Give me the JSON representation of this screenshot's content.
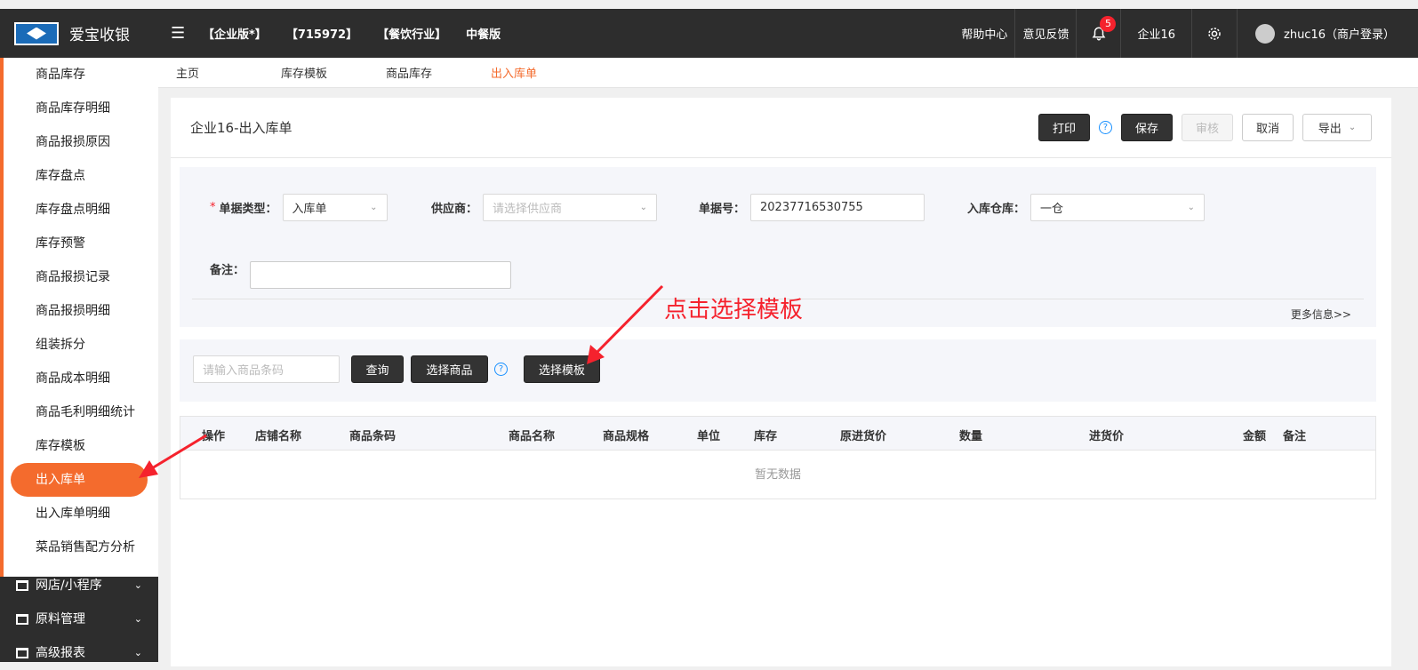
{
  "app": {
    "title": "爱宝收银"
  },
  "topbar": {
    "tags": [
      "【企业版*】",
      "【715972】",
      "【餐饮行业】",
      "中餐版"
    ],
    "help": "帮助中心",
    "feedback": "意见反馈",
    "notification_count": "5",
    "company": "企业16",
    "user": "zhuc16（商户登录）"
  },
  "sidebar": {
    "sub_items": [
      "商品库存",
      "商品库存明细",
      "商品报损原因",
      "库存盘点",
      "库存盘点明细",
      "库存预警",
      "商品报损记录",
      "商品报损明细",
      "组装拆分",
      "商品成本明细",
      "商品毛利明细统计",
      "库存模板",
      "出入库单",
      "出入库单明细",
      "菜品销售配方分析"
    ],
    "active": "出入库单",
    "main_items": [
      "网店/小程序",
      "原料管理",
      "高级报表"
    ]
  },
  "tabs": [
    "主页",
    "库存模板",
    "商品库存",
    "出入库单"
  ],
  "page": {
    "title": "企业16-出入库单",
    "actions": {
      "print": "打印",
      "save": "保存",
      "audit": "审核",
      "cancel": "取消",
      "export": "导出"
    }
  },
  "form": {
    "doc_type_label": "单据类型：",
    "doc_type_value": "入库单",
    "supplier_label": "供应商：",
    "supplier_placeholder": "请选择供应商",
    "doc_no_label": "单据号：",
    "doc_no_value": "20237716530755",
    "warehouse_label": "入库仓库：",
    "warehouse_value": "一仓",
    "remark_label": "备注：",
    "more_info": "更多信息>>"
  },
  "search": {
    "placeholder": "请输入商品条码",
    "query": "查询",
    "select_goods": "选择商品",
    "select_template": "选择模板"
  },
  "table": {
    "columns": [
      "操作",
      "店铺名称",
      "商品条码",
      "商品名称",
      "商品规格",
      "单位",
      "库存",
      "原进货价",
      "数量",
      "进货价",
      "金额",
      "备注"
    ],
    "empty": "暂无数据"
  },
  "annotation": {
    "text": "点击选择模板",
    "color": "#f5222d"
  },
  "colors": {
    "accent": "#f46b2d",
    "dark": "#2d2d2d"
  }
}
